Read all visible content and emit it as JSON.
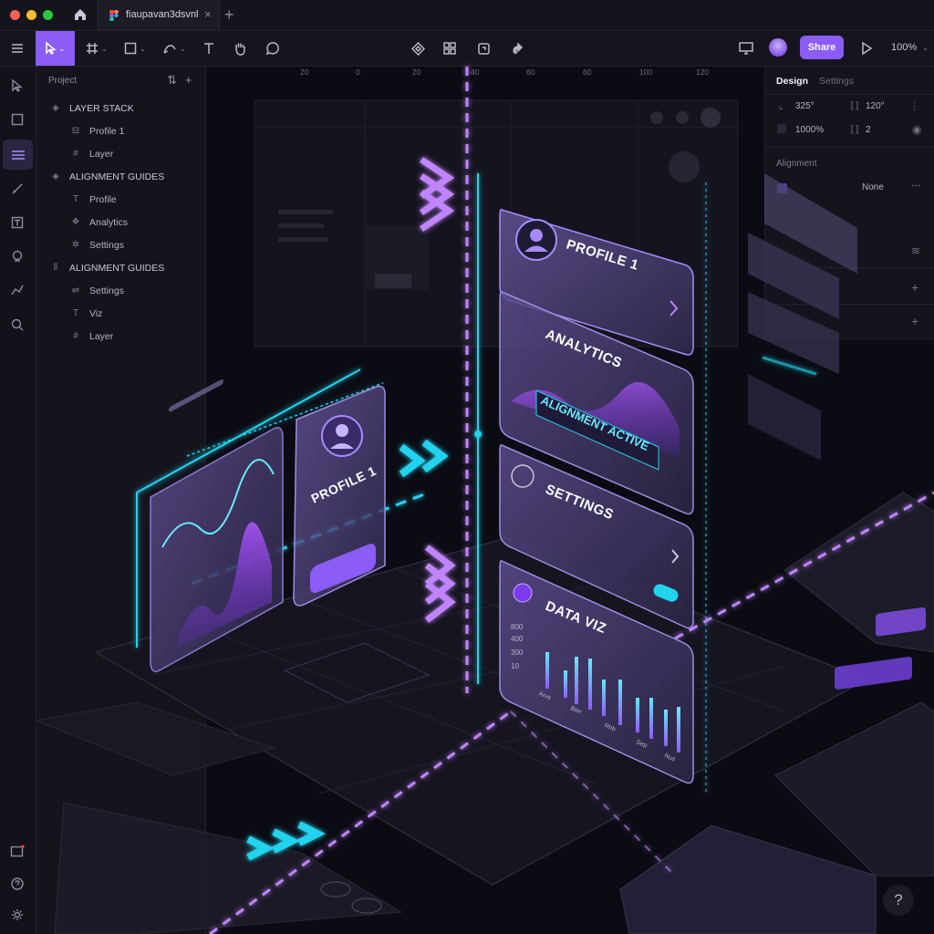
{
  "window": {
    "tab_title": "fiaupavan3dsvnl",
    "tab_close": "×",
    "new_tab": "+"
  },
  "toolbar": {
    "share_label": "Share",
    "zoom_level": "100%",
    "accent_color": "#8b5cf6"
  },
  "layers_panel": {
    "header": "Project",
    "header_icons": "⇅+",
    "rows": [
      {
        "label": "LAYER STACK",
        "icon": "stack-icon",
        "glyph": "◈",
        "kind": "group"
      },
      {
        "label": "Profile 1",
        "icon": "frame-icon",
        "glyph": "⊟",
        "kind": "sub"
      },
      {
        "label": "Layer",
        "icon": "hash-icon",
        "glyph": "#",
        "kind": "sub"
      },
      {
        "label": "ALIGNMENT GUIDES",
        "icon": "stack-icon",
        "glyph": "◈",
        "kind": "group"
      },
      {
        "label": "Profile",
        "icon": "text-icon",
        "glyph": "T",
        "kind": "sub"
      },
      {
        "label": "Analytics",
        "icon": "component-icon",
        "glyph": "❖",
        "kind": "sub"
      },
      {
        "label": "Settings",
        "icon": "gear-icon",
        "glyph": "✲",
        "kind": "sub"
      },
      {
        "label": "ALIGNMENT GUIDES",
        "icon": "guides-icon",
        "glyph": "⦀",
        "kind": "top"
      },
      {
        "label": "Settings",
        "icon": "link-icon",
        "glyph": "⇌",
        "kind": "sub"
      },
      {
        "label": "Viz",
        "icon": "text-icon",
        "glyph": "T",
        "kind": "sub"
      },
      {
        "label": "Layer",
        "icon": "hash-icon",
        "glyph": "#",
        "kind": "sub"
      }
    ]
  },
  "properties_panel": {
    "tabs": [
      "Design",
      "Settings"
    ],
    "x_value": "325°",
    "angle_value": "120°",
    "opacity_value": "1000%",
    "stroke_value": "2",
    "section_alignment": "Alignment",
    "alignment_value": "None",
    "more": "···"
  },
  "ruler": {
    "ticks": [
      "20",
      "0",
      "20",
      "40",
      "60",
      "60",
      "100",
      "120"
    ]
  },
  "cards": {
    "profile": "PROFILE 1",
    "analytics": "ANALYTICS",
    "alignment_badge": "ALIGNMENT ACTIVE",
    "settings": "SETTINGS",
    "data_viz": "DATA VIZ",
    "left_profile": "PROFILE 1",
    "y_ticks": [
      "800",
      "400",
      "300",
      "10"
    ],
    "x_ticks": [
      "Arvs",
      "Bier",
      "Rhb",
      "Sep",
      "Nus"
    ]
  },
  "help": "?"
}
